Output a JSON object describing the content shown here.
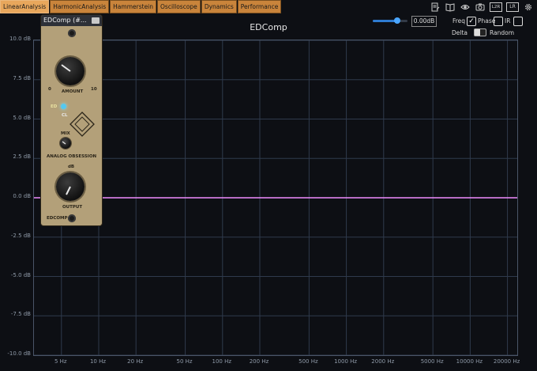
{
  "tabs": [
    {
      "label": "LinearAnalysis",
      "active": true
    },
    {
      "label": "HarmonicAnalysis",
      "active": false
    },
    {
      "label": "Hammerstein",
      "active": false
    },
    {
      "label": "Oscilloscope",
      "active": false
    },
    {
      "label": "Dynamics",
      "active": false
    },
    {
      "label": "Performance",
      "active": false
    }
  ],
  "toolbar_icons": [
    "notes-icon",
    "book-icon",
    "eye-icon",
    "camera-icon",
    "l2r-icon",
    "lr-icon",
    "gear-icon"
  ],
  "toolbar_icon_text": {
    "l2r": "L2R",
    "lr": "LR"
  },
  "title": "EDComp",
  "gain": {
    "value": "0.00dB",
    "slider_fraction": 0.7
  },
  "options": {
    "freq_label": "Freq",
    "freq_checked": true,
    "phase_label": "Phase",
    "phase_checked": false,
    "ir_label": "IR",
    "ir_checked": false,
    "delta_label": "Delta",
    "random_label": "Random",
    "check_mark": "✓"
  },
  "plot": {
    "y_labels": [
      "10.0 dB",
      "7.5 dB",
      "5.0 dB",
      "2.5 dB",
      "0.0 dB",
      "-2.5 dB",
      "-5.0 dB",
      "-7.5 dB",
      "-10.0 dB"
    ],
    "x_labels": [
      "5 Hz",
      "10 Hz",
      "20 Hz",
      "50 Hz",
      "100 Hz",
      "200 Hz",
      "500 Hz",
      "1000 Hz",
      "2000 Hz",
      "5000 Hz",
      "10000 Hz",
      "20000 Hz"
    ],
    "response_db": 0.0,
    "colors": {
      "grid": "#2f3a4c",
      "trace": "#f08cff"
    }
  },
  "plugin": {
    "window_title": "EDComp (#...",
    "amount_label": "AMOUNT",
    "ed_label": "ED",
    "cl_label": "CL",
    "mix_label": "MIX",
    "brand_label": "ANALOG OBSESSION",
    "output_label": "OUTPUT",
    "db_label": "dB",
    "footer_label": "EDCOMP",
    "scale_min": "0",
    "scale_max": "10"
  }
}
